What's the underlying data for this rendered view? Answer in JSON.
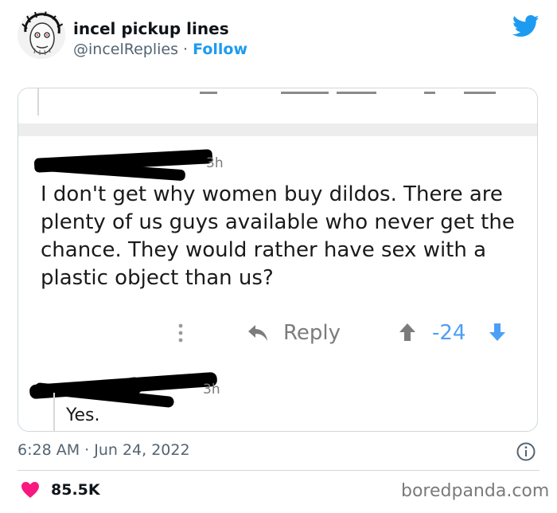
{
  "tweet": {
    "author_name": "incel pickup lines",
    "handle": "@incelReplies",
    "separator": " · ",
    "follow_label": "Follow",
    "timestamp": "6:28 AM · Jun 24, 2022",
    "likes": "85.5K"
  },
  "screenshot": {
    "comment_time_fragment": "3h",
    "reply_time_fragment": "3h",
    "comment_text": "I don't get why women buy dildos. There are plenty of us guys available who never get the chance. They would rather have sex with a plastic object than us?",
    "reply_label": "Reply",
    "score": "-24",
    "reply_text": "Yes."
  },
  "icons": {
    "twitter": "twitter-bird-icon",
    "more": "more-vertical-icon",
    "reply": "reply-arrow-icon",
    "upvote": "upvote-arrow-icon",
    "downvote": "downvote-arrow-icon",
    "info": "info-icon",
    "heart": "heart-icon"
  },
  "colors": {
    "twitter_blue": "#1d9bf0",
    "vote_blue": "#4c9ff5",
    "heart_red": "#f91880",
    "muted_text": "#536471"
  },
  "watermark": "boredpanda.com"
}
